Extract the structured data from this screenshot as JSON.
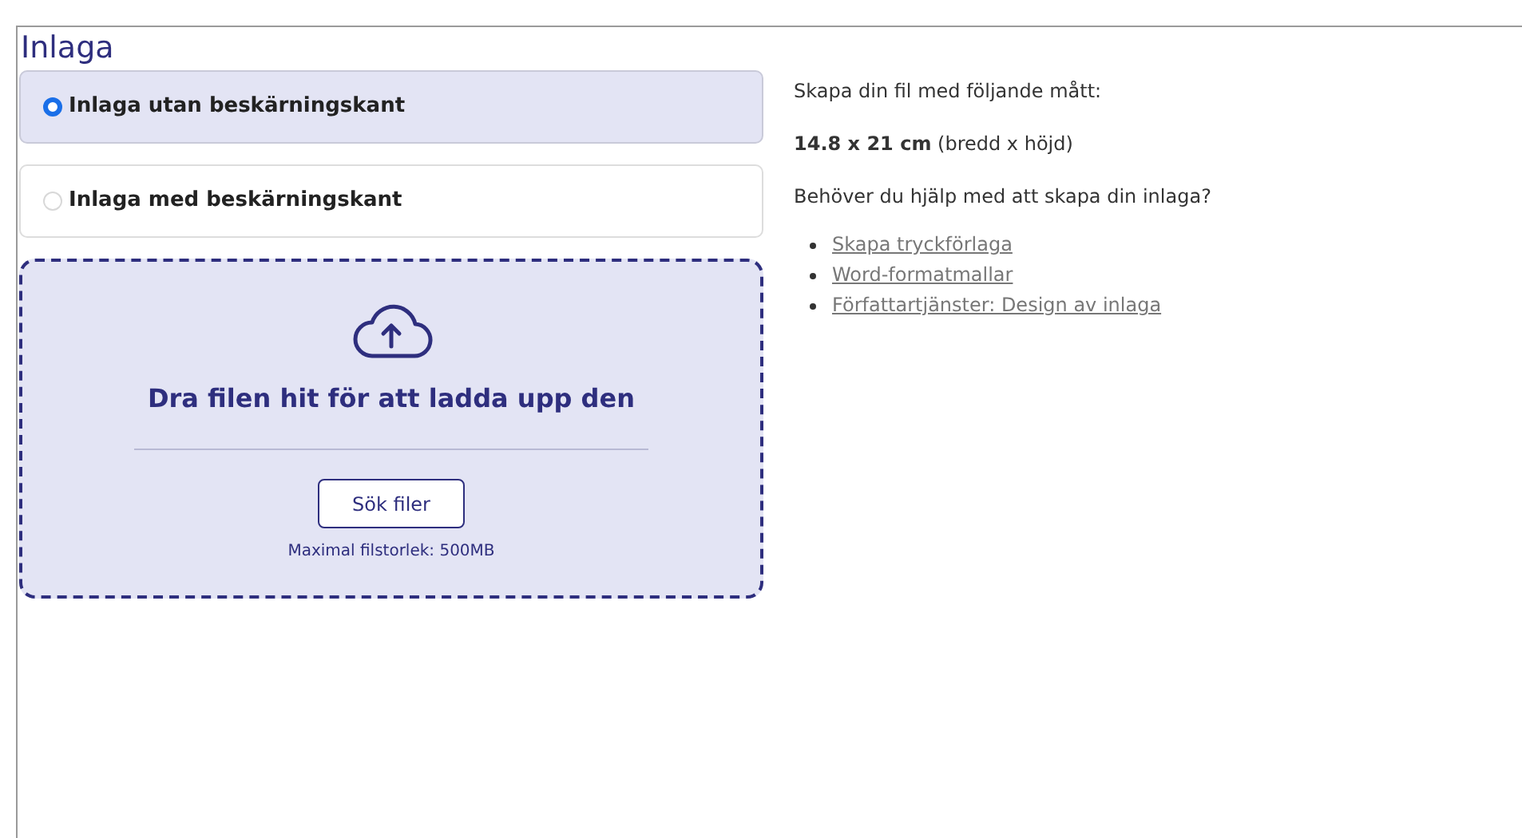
{
  "title": "Inlaga",
  "options": [
    {
      "label": "Inlaga utan beskärningskant",
      "selected": true
    },
    {
      "label": "Inlaga med beskärningskant",
      "selected": false
    }
  ],
  "dropzone": {
    "heading": "Dra filen hit för att ladda upp den",
    "button": "Sök filer",
    "note": "Maximal filstorlek: 500MB"
  },
  "info": {
    "intro": "Skapa din fil med följande mått:",
    "dimensions": "**14.8 x 21 cm** (bredd x höjd)",
    "help": "Behöver du hjälp med att skapa din inlaga?",
    "links": [
      "Skapa tryckförlaga",
      "Word-formatmallar",
      "Författartjänster: Design av inlaga"
    ]
  }
}
